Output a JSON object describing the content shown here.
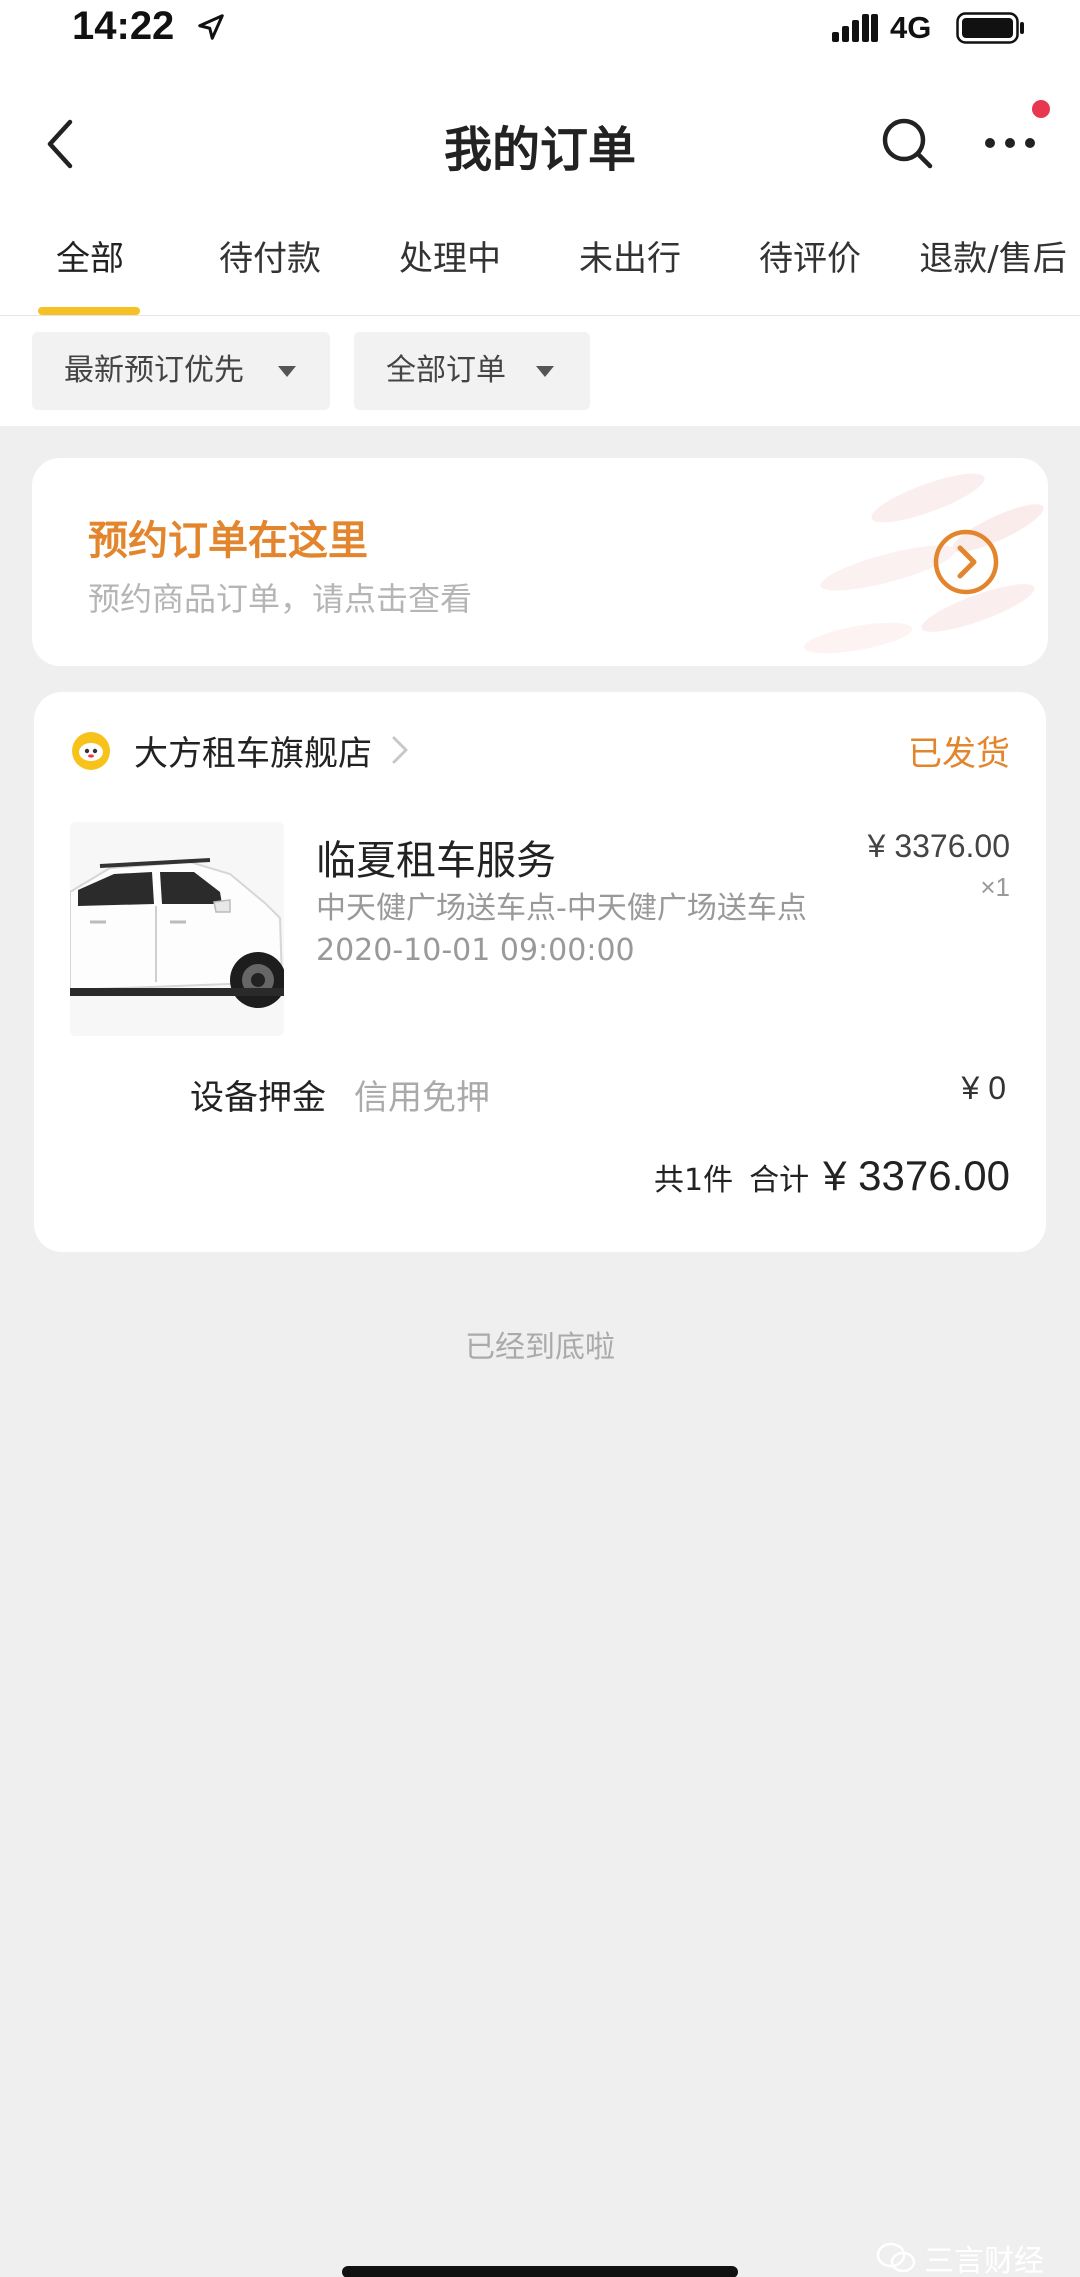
{
  "status_bar": {
    "time": "14:22",
    "network": "4G"
  },
  "header": {
    "title": "我的订单"
  },
  "tabs": [
    {
      "label": "全部"
    },
    {
      "label": "待付款"
    },
    {
      "label": "处理中"
    },
    {
      "label": "未出行"
    },
    {
      "label": "待评价"
    },
    {
      "label": "退款/售后"
    }
  ],
  "filters": [
    {
      "label": "最新预订优先"
    },
    {
      "label": "全部订单"
    }
  ],
  "promo": {
    "title": "预约订单在这里",
    "subtitle": "预约商品订单，请点击查看"
  },
  "order": {
    "shop_name": "大方租车旗舰店",
    "status": "已发货",
    "product_name": "临夏租车服务",
    "product_desc": "中天健广场送车点-中天健广场送车点 2020-10-01 09:00:00",
    "price": "¥ 3376.00",
    "quantity": "×1",
    "deposit_label": "设备押金",
    "deposit_value": "信用免押",
    "deposit_amount": "¥ 0",
    "total_count": "共1件",
    "total_label": "合计",
    "total_amount": "¥ 3376.00"
  },
  "end_text": "已经到底啦",
  "watermark": "三言财经",
  "colors": {
    "accent": "#e2852c",
    "tab_indicator": "#f5c124",
    "badge": "#e8384f"
  }
}
